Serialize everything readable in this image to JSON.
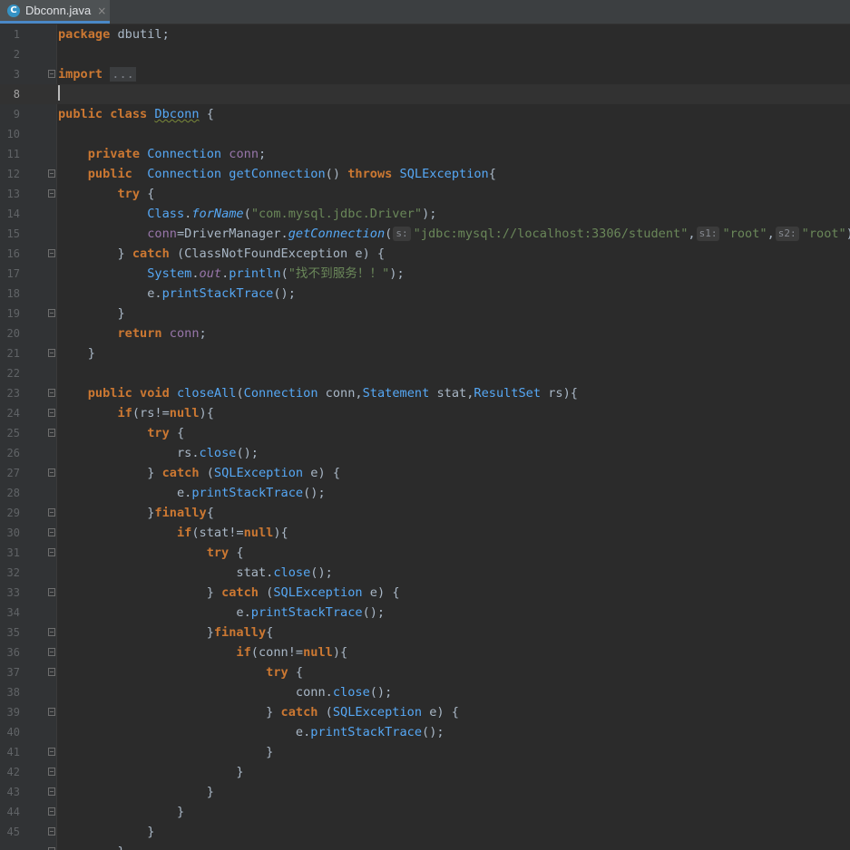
{
  "tab": {
    "file_name": "Dbconn.java",
    "icon_letter": "C",
    "close_glyph": "×"
  },
  "current_line": 4,
  "lines": [
    {
      "no": "1",
      "tokens": [
        [
          "k",
          "package"
        ],
        [
          "p",
          " "
        ],
        [
          "p",
          "dbutil"
        ],
        [
          "p",
          ";"
        ]
      ]
    },
    {
      "no": "2",
      "tokens": []
    },
    {
      "no": "3",
      "fold": true,
      "tokens": [
        [
          "k",
          "import"
        ],
        [
          "p",
          " "
        ],
        [
          "dots",
          "..."
        ]
      ]
    },
    {
      "no": "8",
      "caret": true,
      "tokens": []
    },
    {
      "no": "9",
      "tokens": [
        [
          "k",
          "public"
        ],
        [
          "p",
          " "
        ],
        [
          "k",
          "class"
        ],
        [
          "p",
          " "
        ],
        [
          "cw",
          "Dbconn"
        ],
        [
          "p",
          " {"
        ]
      ]
    },
    {
      "no": "10",
      "tokens": []
    },
    {
      "no": "11",
      "tokens": [
        [
          "sp",
          "    "
        ],
        [
          "k",
          "private"
        ],
        [
          "p",
          " "
        ],
        [
          "c",
          "Connection"
        ],
        [
          "p",
          " "
        ],
        [
          "f",
          "conn"
        ],
        [
          "p",
          ";"
        ]
      ]
    },
    {
      "no": "12",
      "fold": true,
      "tokens": [
        [
          "sp",
          "    "
        ],
        [
          "k",
          "public"
        ],
        [
          "p",
          "  "
        ],
        [
          "c",
          "Connection"
        ],
        [
          "p",
          " "
        ],
        [
          "m",
          "getConnection"
        ],
        [
          "p",
          "() "
        ],
        [
          "k",
          "throws"
        ],
        [
          "p",
          " "
        ],
        [
          "c",
          "SQLException"
        ],
        [
          "p",
          "{"
        ]
      ]
    },
    {
      "no": "13",
      "fold": true,
      "tokens": [
        [
          "sp",
          "        "
        ],
        [
          "k",
          "try"
        ],
        [
          "p",
          " {"
        ]
      ]
    },
    {
      "no": "14",
      "tokens": [
        [
          "sp",
          "            "
        ],
        [
          "c",
          "Class"
        ],
        [
          "p",
          "."
        ],
        [
          "mi",
          "forName"
        ],
        [
          "p",
          "("
        ],
        [
          "s",
          "\"com.mysql.jdbc.Driver\""
        ],
        [
          "p",
          ");"
        ]
      ]
    },
    {
      "no": "15",
      "tokens": [
        [
          "sp",
          "            "
        ],
        [
          "f",
          "conn"
        ],
        [
          "p",
          "=DriverManager."
        ],
        [
          "mi",
          "getConnection"
        ],
        [
          "p",
          "("
        ],
        [
          "h",
          "s:"
        ],
        [
          "s",
          "\"jdbc:mysql://localhost:3306/student\""
        ],
        [
          "p",
          ","
        ],
        [
          "h",
          "s1:"
        ],
        [
          "s",
          "\"root\""
        ],
        [
          "p",
          ","
        ],
        [
          "h",
          "s2:"
        ],
        [
          "s",
          "\"root\""
        ],
        [
          "p",
          ");"
        ]
      ]
    },
    {
      "no": "16",
      "fold": true,
      "tokens": [
        [
          "sp",
          "        "
        ],
        [
          "p",
          "} "
        ],
        [
          "k",
          "catch"
        ],
        [
          "p",
          " (ClassNotFoundException e) {"
        ]
      ]
    },
    {
      "no": "17",
      "tokens": [
        [
          "sp",
          "            "
        ],
        [
          "c",
          "System"
        ],
        [
          "p",
          "."
        ],
        [
          "fi",
          "out"
        ],
        [
          "p",
          "."
        ],
        [
          "m",
          "println"
        ],
        [
          "p",
          "("
        ],
        [
          "s",
          "\"找不到服务！！\""
        ],
        [
          "p",
          ");"
        ]
      ]
    },
    {
      "no": "18",
      "tokens": [
        [
          "sp",
          "            "
        ],
        [
          "p",
          "e."
        ],
        [
          "m",
          "printStackTrace"
        ],
        [
          "p",
          "();"
        ]
      ]
    },
    {
      "no": "19",
      "fold": true,
      "tokens": [
        [
          "sp",
          "        "
        ],
        [
          "p",
          "}"
        ]
      ]
    },
    {
      "no": "20",
      "tokens": [
        [
          "sp",
          "        "
        ],
        [
          "k",
          "return"
        ],
        [
          "p",
          " "
        ],
        [
          "f",
          "conn"
        ],
        [
          "p",
          ";"
        ]
      ]
    },
    {
      "no": "21",
      "fold": true,
      "tokens": [
        [
          "sp",
          "    "
        ],
        [
          "p",
          "}"
        ]
      ]
    },
    {
      "no": "22",
      "tokens": []
    },
    {
      "no": "23",
      "fold": true,
      "tokens": [
        [
          "sp",
          "    "
        ],
        [
          "k",
          "public"
        ],
        [
          "p",
          " "
        ],
        [
          "k",
          "void"
        ],
        [
          "p",
          " "
        ],
        [
          "m",
          "closeAll"
        ],
        [
          "p",
          "("
        ],
        [
          "c",
          "Connection"
        ],
        [
          "p",
          " conn,"
        ],
        [
          "c",
          "Statement"
        ],
        [
          "p",
          " stat,"
        ],
        [
          "c",
          "ResultSet"
        ],
        [
          "p",
          " rs){"
        ]
      ]
    },
    {
      "no": "24",
      "fold": true,
      "tokens": [
        [
          "sp",
          "        "
        ],
        [
          "k",
          "if"
        ],
        [
          "p",
          "(rs!="
        ],
        [
          "k",
          "null"
        ],
        [
          "p",
          "){"
        ]
      ]
    },
    {
      "no": "25",
      "fold": true,
      "tokens": [
        [
          "sp",
          "            "
        ],
        [
          "k",
          "try"
        ],
        [
          "p",
          " {"
        ]
      ]
    },
    {
      "no": "26",
      "tokens": [
        [
          "sp",
          "                "
        ],
        [
          "p",
          "rs."
        ],
        [
          "m",
          "close"
        ],
        [
          "p",
          "();"
        ]
      ]
    },
    {
      "no": "27",
      "fold": true,
      "tokens": [
        [
          "sp",
          "            "
        ],
        [
          "p",
          "} "
        ],
        [
          "k",
          "catch"
        ],
        [
          "p",
          " ("
        ],
        [
          "c",
          "SQLException"
        ],
        [
          "p",
          " e) {"
        ]
      ]
    },
    {
      "no": "28",
      "tokens": [
        [
          "sp",
          "                "
        ],
        [
          "p",
          "e."
        ],
        [
          "m",
          "printStackTrace"
        ],
        [
          "p",
          "();"
        ]
      ]
    },
    {
      "no": "29",
      "fold": true,
      "tokens": [
        [
          "sp",
          "            "
        ],
        [
          "p",
          "}"
        ],
        [
          "k",
          "finally"
        ],
        [
          "p",
          "{"
        ]
      ]
    },
    {
      "no": "30",
      "fold": true,
      "tokens": [
        [
          "sp",
          "                "
        ],
        [
          "k",
          "if"
        ],
        [
          "p",
          "(stat!="
        ],
        [
          "k",
          "null"
        ],
        [
          "p",
          "){"
        ]
      ]
    },
    {
      "no": "31",
      "fold": true,
      "tokens": [
        [
          "sp",
          "                    "
        ],
        [
          "k",
          "try"
        ],
        [
          "p",
          " {"
        ]
      ]
    },
    {
      "no": "32",
      "tokens": [
        [
          "sp",
          "                        "
        ],
        [
          "p",
          "stat."
        ],
        [
          "m",
          "close"
        ],
        [
          "p",
          "();"
        ]
      ]
    },
    {
      "no": "33",
      "fold": true,
      "tokens": [
        [
          "sp",
          "                    "
        ],
        [
          "p",
          "} "
        ],
        [
          "k",
          "catch"
        ],
        [
          "p",
          " ("
        ],
        [
          "c",
          "SQLException"
        ],
        [
          "p",
          " e) {"
        ]
      ]
    },
    {
      "no": "34",
      "tokens": [
        [
          "sp",
          "                        "
        ],
        [
          "p",
          "e."
        ],
        [
          "m",
          "printStackTrace"
        ],
        [
          "p",
          "();"
        ]
      ]
    },
    {
      "no": "35",
      "fold": true,
      "tokens": [
        [
          "sp",
          "                    "
        ],
        [
          "p",
          "}"
        ],
        [
          "k",
          "finally"
        ],
        [
          "p",
          "{"
        ]
      ]
    },
    {
      "no": "36",
      "fold": true,
      "tokens": [
        [
          "sp",
          "                        "
        ],
        [
          "k",
          "if"
        ],
        [
          "p",
          "(conn!="
        ],
        [
          "k",
          "null"
        ],
        [
          "p",
          "){"
        ]
      ]
    },
    {
      "no": "37",
      "fold": true,
      "tokens": [
        [
          "sp",
          "                            "
        ],
        [
          "k",
          "try"
        ],
        [
          "p",
          " {"
        ]
      ]
    },
    {
      "no": "38",
      "tokens": [
        [
          "sp",
          "                                "
        ],
        [
          "p",
          "conn."
        ],
        [
          "m",
          "close"
        ],
        [
          "p",
          "();"
        ]
      ]
    },
    {
      "no": "39",
      "fold": true,
      "tokens": [
        [
          "sp",
          "                            "
        ],
        [
          "p",
          "} "
        ],
        [
          "k",
          "catch"
        ],
        [
          "p",
          " ("
        ],
        [
          "c",
          "SQLException"
        ],
        [
          "p",
          " e) {"
        ]
      ]
    },
    {
      "no": "40",
      "tokens": [
        [
          "sp",
          "                                "
        ],
        [
          "p",
          "e."
        ],
        [
          "m",
          "printStackTrace"
        ],
        [
          "p",
          "();"
        ]
      ]
    },
    {
      "no": "41",
      "fold": true,
      "tokens": [
        [
          "sp",
          "                            "
        ],
        [
          "p",
          "}"
        ]
      ]
    },
    {
      "no": "42",
      "fold": true,
      "tokens": [
        [
          "sp",
          "                        "
        ],
        [
          "p",
          "}"
        ]
      ]
    },
    {
      "no": "43",
      "fold": true,
      "tokens": [
        [
          "sp",
          "                    "
        ],
        [
          "p",
          "}"
        ]
      ]
    },
    {
      "no": "44",
      "fold": true,
      "tokens": [
        [
          "sp",
          "                "
        ],
        [
          "p",
          "}"
        ]
      ]
    },
    {
      "no": "45",
      "fold": true,
      "tokens": [
        [
          "sp",
          "            "
        ],
        [
          "p",
          "}"
        ]
      ]
    },
    {
      "no": "",
      "fold": true,
      "tokens": [
        [
          "sp",
          "        "
        ],
        [
          "p",
          "}"
        ]
      ]
    }
  ]
}
